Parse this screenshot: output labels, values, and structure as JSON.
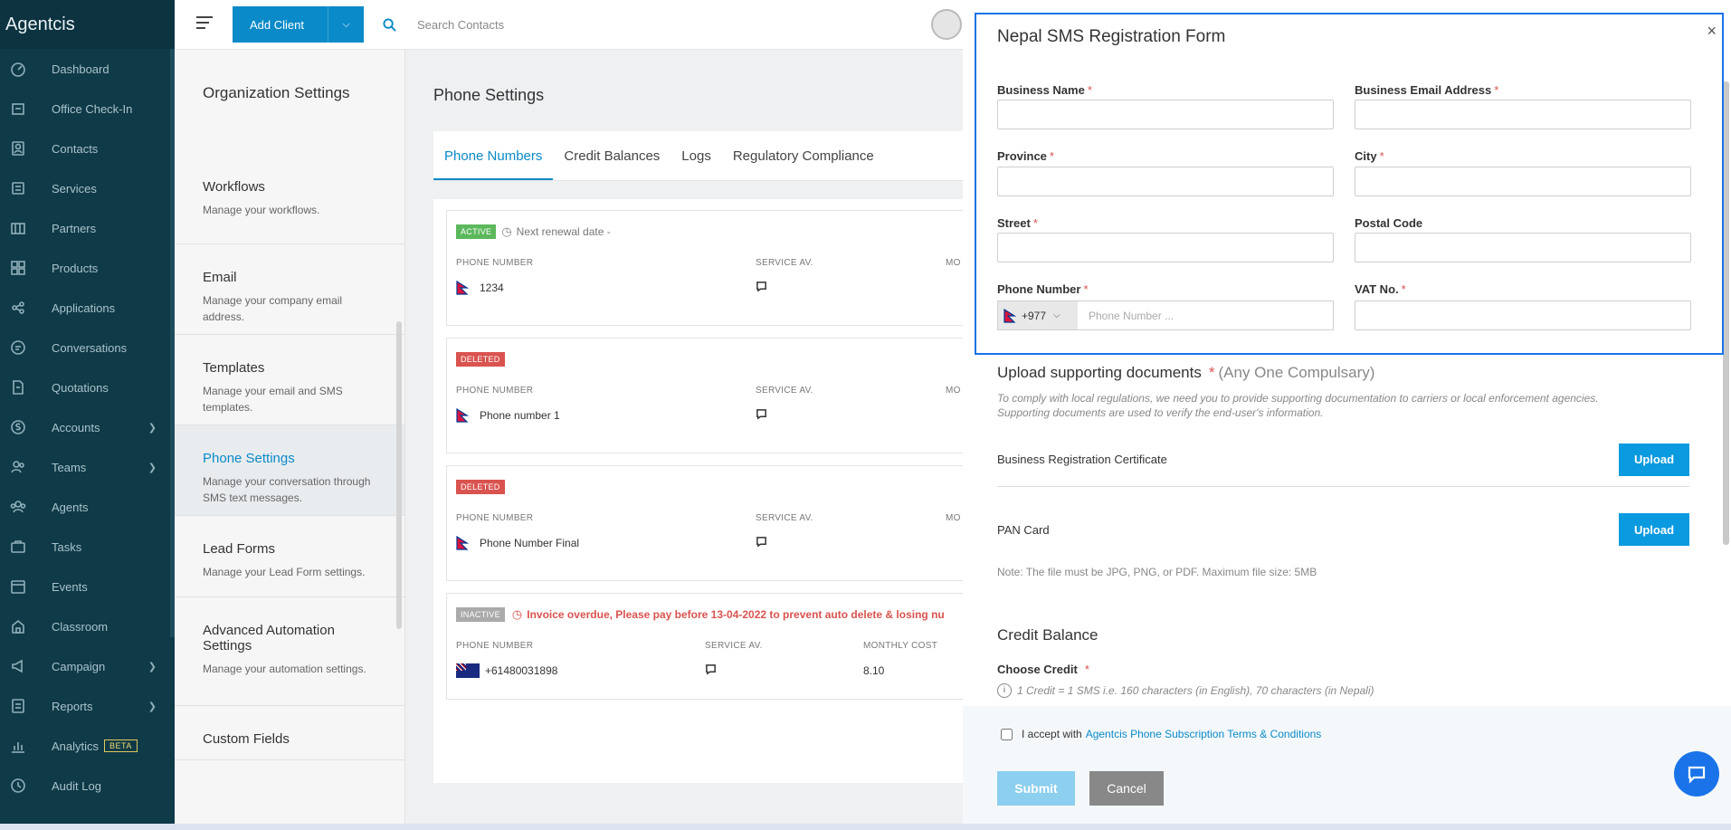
{
  "app": {
    "brand": "Agentcis"
  },
  "sidebar": {
    "items": [
      {
        "label": "Dashboard",
        "icon": "speedometer-icon",
        "arrow": false
      },
      {
        "label": "Office Check-In",
        "icon": "checkin-icon",
        "arrow": false
      },
      {
        "label": "Contacts",
        "icon": "contacts-icon",
        "arrow": false
      },
      {
        "label": "Services",
        "icon": "services-icon",
        "arrow": false
      },
      {
        "label": "Partners",
        "icon": "partners-icon",
        "arrow": false
      },
      {
        "label": "Products",
        "icon": "products-icon",
        "arrow": false
      },
      {
        "label": "Applications",
        "icon": "applications-icon",
        "arrow": false
      },
      {
        "label": "Conversations",
        "icon": "conversations-icon",
        "arrow": false
      },
      {
        "label": "Quotations",
        "icon": "quotations-icon",
        "arrow": false
      },
      {
        "label": "Accounts",
        "icon": "accounts-icon",
        "arrow": true
      },
      {
        "label": "Teams",
        "icon": "teams-icon",
        "arrow": true
      },
      {
        "label": "Agents",
        "icon": "agents-icon",
        "arrow": false
      },
      {
        "label": "Tasks",
        "icon": "tasks-icon",
        "arrow": false
      },
      {
        "label": "Events",
        "icon": "events-icon",
        "arrow": false
      },
      {
        "label": "Classroom",
        "icon": "classroom-icon",
        "arrow": false
      },
      {
        "label": "Campaign",
        "icon": "campaign-icon",
        "arrow": true
      },
      {
        "label": "Reports",
        "icon": "reports-icon",
        "arrow": true
      },
      {
        "label": "Analytics",
        "icon": "analytics-icon",
        "arrow": false,
        "badge": "BETA"
      },
      {
        "label": "Audit Log",
        "icon": "audit-log-icon",
        "arrow": false
      }
    ]
  },
  "topbar": {
    "add_client_label": "Add Client",
    "search_placeholder": "Search Contacts"
  },
  "settings": {
    "title": "Organization Settings",
    "items": [
      {
        "title": "Workflows",
        "desc": "Manage your workflows.",
        "active": false
      },
      {
        "title": "Email",
        "desc": "Manage your company email address.",
        "active": false
      },
      {
        "title": "Templates",
        "desc": "Manage your email and SMS templates.",
        "active": false
      },
      {
        "title": "Phone Settings",
        "desc": "Manage your conversation through SMS text messages.",
        "active": true
      },
      {
        "title": "Lead Forms",
        "desc": "Manage your Lead Form settings.",
        "active": false
      },
      {
        "title": "Advanced Automation Settings",
        "desc": "Manage your automation settings.",
        "active": false
      },
      {
        "title": "Custom Fields",
        "desc": "",
        "active": false
      }
    ]
  },
  "phone_settings": {
    "title": "Phone Settings",
    "tabs": [
      {
        "label": "Phone Numbers",
        "active": true
      },
      {
        "label": "Credit Balances",
        "active": false
      },
      {
        "label": "Logs",
        "active": false
      },
      {
        "label": "Regulatory Compliance",
        "active": false
      }
    ],
    "col_phone": "PHONE NUMBER",
    "col_service": "SERVICE AV.",
    "col_service_trunc": "MO",
    "col_monthly": "MONTHLY COST",
    "cards": [
      {
        "status": "ACTIVE",
        "note": "Next renewal date -",
        "number": "1234"
      },
      {
        "status": "DELETED",
        "note": "",
        "number": "Phone number 1"
      },
      {
        "status": "DELETED",
        "note": "",
        "number": "Phone Number Final"
      },
      {
        "status": "INACTIVE",
        "note": "Invoice overdue, Please pay before 13-04-2022 to prevent auto delete & losing nu",
        "number": "+61480031898",
        "monthly": "8.10"
      }
    ]
  },
  "modal": {
    "title": "Nepal SMS Registration Form",
    "close": "×",
    "fields": {
      "business_name": "Business Name",
      "business_email": "Business Email Address",
      "province": "Province",
      "city": "City",
      "street": "Street",
      "postal_code": "Postal Code",
      "phone_number": "Phone Number",
      "vat_no": "VAT No.",
      "country_code": "+977",
      "phone_placeholder": "Phone Number ..."
    },
    "required_mark": "*",
    "upload": {
      "title": "Upload supporting documents",
      "optional_note": "(Any One Compulsary)",
      "desc_line1": "To comply with local regulations, we need you to provide supporting documentation to carriers or local enforcement agencies.",
      "desc_line2": "Supporting documents are used to verify the end-user's information.",
      "docs": [
        "Business Registration Certificate",
        "PAN Card"
      ],
      "button": "Upload",
      "file_note": "Note: The file must be JPG, PNG, or PDF. Maximum file size: 5MB"
    },
    "credit": {
      "title": "Credit Balance",
      "label": "Choose Credit",
      "info": "1 Credit = 1 SMS i.e. 160 characters (in English), 70 characters (in Nepali)"
    },
    "footer": {
      "accept_text": "I accept with",
      "terms_link": "Agentcis Phone Subscription Terms & Conditions",
      "submit": "Submit",
      "cancel": "Cancel"
    }
  }
}
